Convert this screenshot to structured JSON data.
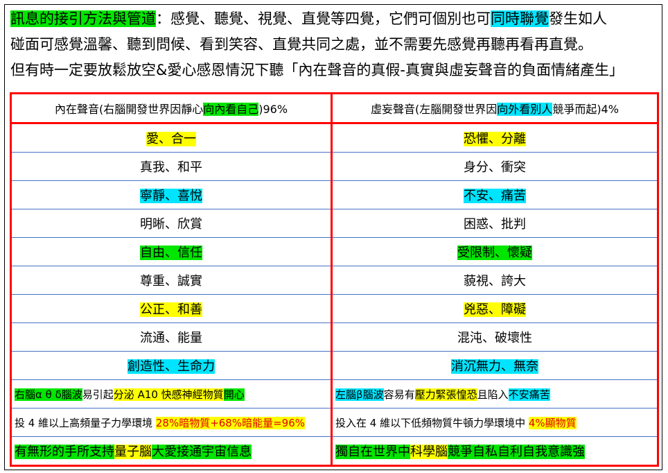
{
  "intro": {
    "line1": {
      "a": "訊息的接引方法與管道",
      "b": "：感覺、聽覺、視覺、直覺等四覺，它們可個別也可",
      "c": "同時聯覺",
      "d": "發生如人"
    },
    "line2": "碰面可感覺溫馨、聽到問候、看到笑容、直覺共同之處，並不需要先感覺再聽再看再直覺。",
    "line3": "但有時一定要放鬆放空&愛心感恩情況下聽「內在聲音的真假-真實與虛妄聲音的負面情緒產生」"
  },
  "header": {
    "left": {
      "a": "內在聲音(右腦開發世界因靜心",
      "b": "向內看自己",
      "c": ")96%"
    },
    "right": {
      "a": "虛妄聲音(左腦開發世界因",
      "b": "向外看別人",
      "c": "競爭而起)4%"
    }
  },
  "rows": [
    {
      "left": "愛、合一",
      "right": "恐懼、分離",
      "hl": "yellow"
    },
    {
      "left": "真我、和平",
      "right": "身分、衝突",
      "hl": ""
    },
    {
      "left": "寧靜、喜悅",
      "right": "不安、痛苦",
      "hl": "cyan"
    },
    {
      "left": "明晰、欣賞",
      "right": "困惑、批判",
      "hl": ""
    },
    {
      "left": "自由、信任",
      "right": "受限制、懷疑",
      "hl": "green"
    },
    {
      "left": "尊重、誠實",
      "right": "藐視、誇大",
      "hl": ""
    },
    {
      "left": "公正、和善",
      "right": "兇惡、障礙",
      "hl": "yellow"
    },
    {
      "left": "流通、能量",
      "right": "混沌、破壞性",
      "hl": ""
    },
    {
      "left": "創造性、生命力",
      "right": "消沉無力、無奈",
      "hl": "cyan"
    }
  ],
  "brain_row": {
    "left": {
      "a": "右腦α θ δ腦波",
      "b": "易引起",
      "c": "分泌 A10 快感神經物質",
      "d": "開心"
    },
    "right": {
      "a": "左腦β腦波",
      "b": "容易有",
      "c": "壓力緊張惶恐",
      "d": "且陷入",
      "e": "不安痛苦"
    }
  },
  "dimension_row": {
    "left": {
      "a": "投 4 維以上高頻量子力學環境 ",
      "b": "28%暗物質+68%暗能量=96%"
    },
    "right": {
      "a": "投入在 4 維以下低頻物質牛頓力學環境中 ",
      "b": "4%顯物質"
    }
  },
  "final_row": {
    "left": {
      "a": "有無形的手所支持",
      "b": "量子腦",
      "c": "大愛接通宇宙信息"
    },
    "right": {
      "a": "獨自在世界中",
      "b": "科學腦",
      "c": "競爭自私自利自我意識強"
    }
  },
  "colors": {
    "green": "#00e600",
    "cyan": "#00e5ff",
    "yellow": "#ffff00",
    "red": "#ff0000",
    "rule": "#4472c4"
  }
}
